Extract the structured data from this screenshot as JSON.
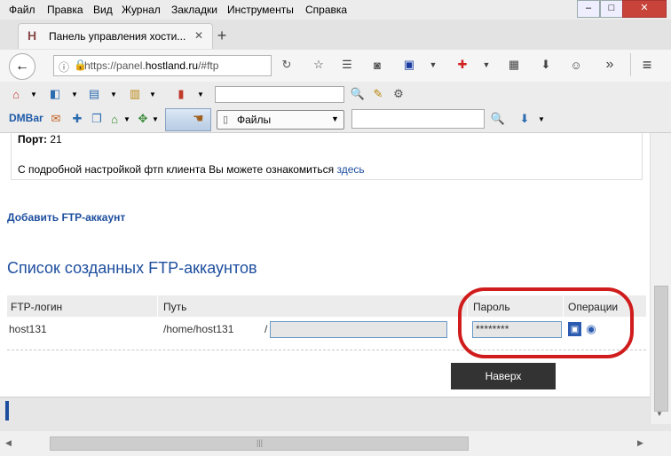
{
  "menu": [
    "Файл",
    "Правка",
    "Вид",
    "Журнал",
    "Закладки",
    "Инструменты",
    "Справка"
  ],
  "tab": {
    "title": "Панель управления хости...",
    "favicon": "H"
  },
  "url": {
    "prefix": "https://panel.",
    "domain": "hostland.ru",
    "suffix": "/#ftp"
  },
  "toolbar": {
    "dmbar": "DMBar",
    "files_label": "Файлы"
  },
  "content": {
    "port_label": "Порт:",
    "port_value": "21",
    "info_text": "С подробной настройкой фтп клиента Вы можете ознакомиться ",
    "info_link": "здесь",
    "add_account": "Добавить FTP-аккаунт",
    "list_title": "Список созданных FTP-аккаунтов",
    "table": {
      "headers": {
        "login": "FTP-логин",
        "path": "Путь",
        "password": "Пароль",
        "operations": "Операции"
      },
      "row": {
        "login": "host131",
        "path": "/home/host131",
        "slash": "/",
        "password": "********"
      }
    },
    "top_button": "Наверх"
  },
  "colors": {
    "link": "#1d4e9e",
    "highlight": "#d01c1c",
    "dark_button": "#333333"
  }
}
